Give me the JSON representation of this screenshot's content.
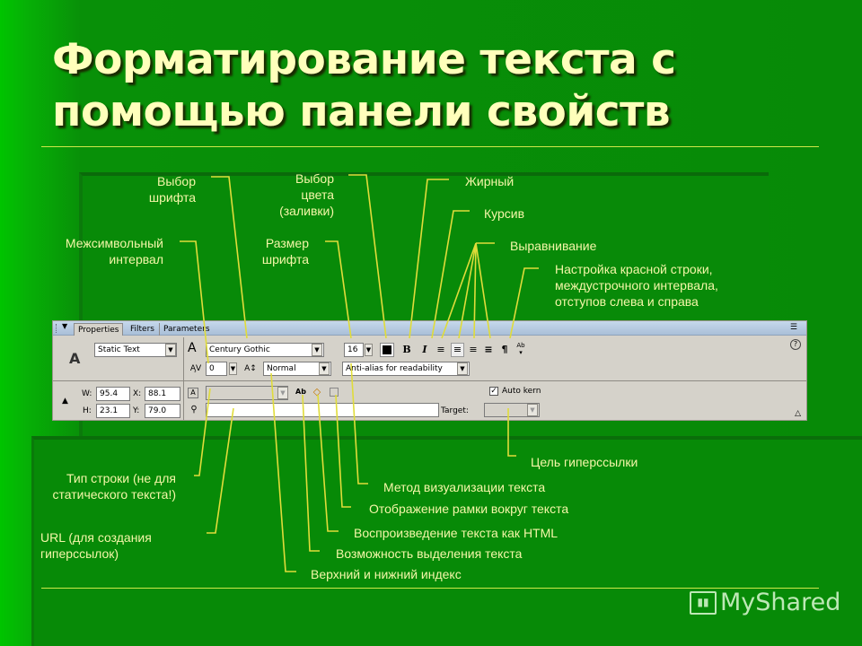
{
  "slide": {
    "title_line1": "Форматирование текста с",
    "title_line2": "помощью панели свойств",
    "colors": {
      "background": "#078a07",
      "title": "#ffffbb",
      "label": "#f4f6a8",
      "leader": "#e0dc3a",
      "rule": "#cfe84a"
    }
  },
  "labels": {
    "font_choice": [
      "Выбор",
      "шрифта"
    ],
    "fill_color": [
      "Выбор",
      "цвета",
      "(заливки)"
    ],
    "bold": "Жирный",
    "italic": "Курсив",
    "letter_spacing": [
      "Межсимвольный",
      "интервал"
    ],
    "font_size": [
      "Размер",
      "шрифта"
    ],
    "alignment": "Выравнивание",
    "paragraph": [
      "Настройка красной строки,",
      "междустрочного интервала,",
      "отступов слева и справа"
    ],
    "line_type": [
      "Тип строки (не для",
      "статического текста!)"
    ],
    "url": [
      "URL (для создания",
      "гиперссылок)"
    ],
    "link_target": "Цель гиперссылки",
    "render_method": "Метод визуализации текста",
    "show_border": "Отображение рамки вокруг текста",
    "render_html": "Воспроизведение текста как HTML",
    "selectable": "Возможность выделения текста",
    "sub_superscript": "Верхний и нижний индекс"
  },
  "panel": {
    "tabs": [
      "Properties",
      "Filters",
      "Parameters"
    ],
    "text_type": "Static Text",
    "font_name": "Century Gothic",
    "font_size": "16",
    "letter_spacing": "0",
    "baseline": "Normal",
    "anti_alias": "Anti-alias for readability",
    "w_label": "W:",
    "w_value": "95.4",
    "h_label": "H:",
    "h_value": "23.1",
    "x_label": "X:",
    "x_value": "88.1",
    "y_label": "Y:",
    "y_value": "79.0",
    "auto_kern_label": "Auto kern",
    "auto_kern_checked": true,
    "target_label": "Target:",
    "url_value": "",
    "fill_color": "#000000",
    "icons": {
      "bold": "B",
      "italic": "I",
      "paragraph": "¶",
      "help": "?",
      "text_tool": "A",
      "lock": "🔒",
      "collapse": "▼",
      "expand": "△"
    }
  },
  "watermark": {
    "brand": "MyShared"
  }
}
